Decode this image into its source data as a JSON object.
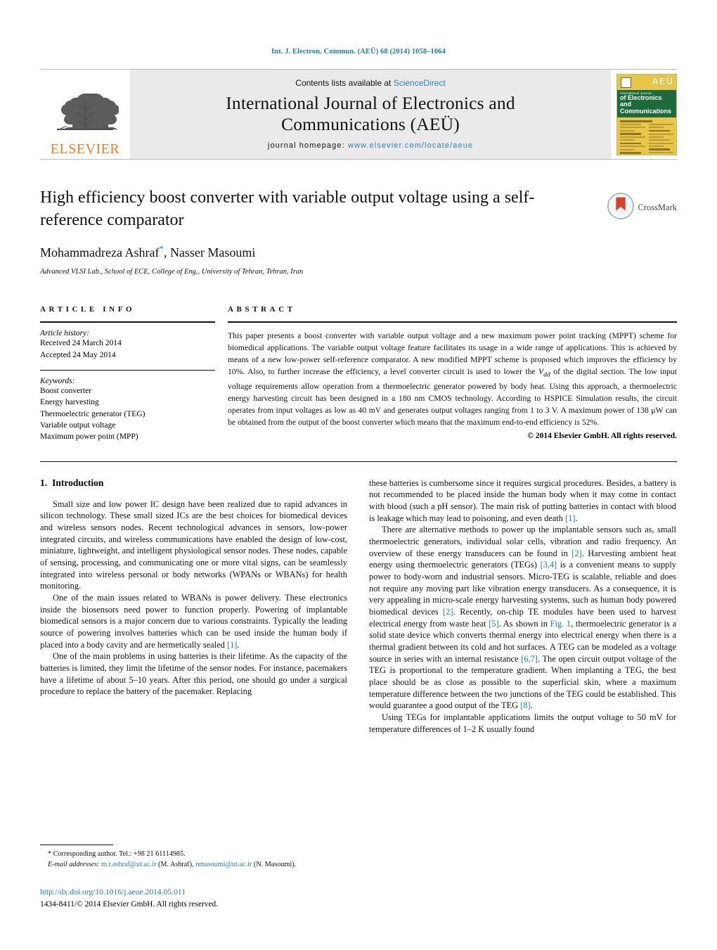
{
  "running_head": "Int. J. Electron. Commun. (AEÜ) 68 (2014) 1058–1064",
  "masthead": {
    "publisher": "ELSEVIER",
    "contents_prefix": "Contents lists available at ",
    "contents_link": "ScienceDirect",
    "journal_title_line1": "International Journal of Electronics and",
    "journal_title_line2": "Communications (AEÜ)",
    "homepage_label": "journal homepage:",
    "homepage_url": "www.elsevier.com/locate/aeue",
    "cover": {
      "aeu": "AEÜ",
      "sub": "International Journal",
      "line1": "of Electronics and",
      "line2": "Communications"
    }
  },
  "article": {
    "title": "High efficiency boost converter with variable output voltage using a self-reference comparator",
    "authors": "Mohammadreza Ashraf",
    "authors_rest": ", Nasser Masoumi",
    "corresponding_marker": "*",
    "affiliation": "Advanced VLSI Lab., School of ECE, College of Eng., University of Tehran, Tehran, Iran",
    "crossmark_label": "CrossMark"
  },
  "info": {
    "heading": "ARTICLE INFO",
    "history_label": "Article history:",
    "received": "Received 24 March 2014",
    "accepted": "Accepted 24 May 2014",
    "keywords_label": "Keywords:",
    "keywords": [
      "Boost converter",
      "Energy harvesting",
      "Thermoelectric generator (TEG)",
      "Variable output voltage",
      "Maximum power point (MPP)"
    ]
  },
  "abstract": {
    "heading": "ABSTRACT",
    "text": "This paper presents a boost converter with variable output voltage and a new maximum power point tracking (MPPT) scheme for biomedical applications. The variable output voltage feature facilitates its usage in a wide range of applications. This is achieved by means of a new low-power self-reference comparator. A new modified MPPT scheme is proposed which improves the efficiency by 10%. Also, to further increase the efficiency, a level converter circuit is used to lower the Vdd of the digital section. The low input voltage requirements allow operation from a thermoelectric generator powered by body heat. Using this approach, a thermoelectric energy harvesting circuit has been designed in a 180 nm CMOS technology. According to HSPICE Simulation results, the circuit operates from input voltages as low as 40 mV and generates output voltages ranging from 1 to 3 V. A maximum power of 138 μW can be obtained from the output of the boost converter which means that the maximum end-to-end efficiency is 52%.",
    "copyright": "© 2014 Elsevier GmbH. All rights reserved."
  },
  "body": {
    "section_number": "1.",
    "section_title": "Introduction",
    "left_paragraphs": [
      "Small size and low power IC design have been realized due to rapid advances in silicon technology. These small sized ICs are the best choices for biomedical devices and wireless sensors nodes. Recent technological advances in sensors, low-power integrated circuits, and wireless communications have enabled the design of low-cost, miniature, lightweight, and intelligent physiological sensor nodes. These nodes, capable of sensing, processing, and communicating one or more vital signs, can be seamlessly integrated into wireless personal or body networks (WPANs or WBANs) for health monitoring.",
      "One of the main issues related to WBANs is power delivery. These electronics inside the biosensors need power to function properly. Powering of implantable biomedical sensors is a major concern due to various constraints. Typically the leading source of powering involves batteries which can be used inside the human body if placed into a body cavity and are hermetically sealed [1].",
      "One of the main problems in using batteries is their lifetime. As the capacity of the batteries is limited, they limit the lifetime of the sensor nodes. For instance, pacemakers have a lifetime of about 5–10 years. After this period, one should go under a surgical procedure to replace the battery of the pacemaker. Replacing"
    ],
    "right_paragraphs": [
      "these batteries is cumbersome since it requires surgical procedures. Besides, a battery is not recommended to be placed inside the human body when it may come in contact with blood (such a pH sensor). The main risk of putting batteries in contact with blood is leakage which may lead to poisoning, and even death [1].",
      "There are alternative methods to power up the implantable sensors such as, small thermoelectric generators, individual solar cells, vibration and radio frequency. An overview of these energy transducers can be found in [2]. Harvesting ambient heat energy using thermoelectric generators (TEGs) [3,4] is a convenient means to supply power to body-worn and industrial sensors. Micro-TEG is scalable, reliable and does not require any moving part like vibration energy transducers. As a consequence, it is very appealing in micro-scale energy harvesting systems, such as human body powered biomedical devices [2]. Recently, on-chip TE modules have been used to harvest electrical energy from waste heat [5]. As shown in Fig. 1, thermoelectric generator is a solid state device which converts thermal energy into electrical energy when there is a thermal gradient between its cold and hot surfaces. A TEG can be modeled as a voltage source in series with an internal resistance [6,7]. The open circuit output voltage of the TEG is proportional to the temperature gradient. When implanting a TEG, the best place should be as close as possible to the superficial skin, where a maximum temperature difference between the two junctions of the TEG could be established. This would guarantee a good output of the TEG [8].",
      "Using TEGs for implantable applications limits the output voltage to 50 mV for temperature differences of 1–2 K usually found"
    ]
  },
  "footnote": {
    "corresponding": "* Corresponding author. Tel.: +98 21 61114985.",
    "email_label": "E-mail addresses:",
    "email1": "m.r.ashraf@ut.ac.ir",
    "email1_owner": "(M. Ashraf),",
    "email2": "nmasoumi@ut.ac.ir",
    "email2_owner": "(N. Masoumi).",
    "doi": "http://dx.doi.org/10.1016/j.aeue.2014.05.011",
    "issn": "1434-8411/© 2014 Elsevier GmbH. All rights reserved."
  },
  "colors": {
    "link": "#1a7fa8",
    "elsevier_orange": "#f08020",
    "masthead_bg": "#eaeaea",
    "cover_gold": "#e8c64a",
    "cover_green": "#1d6b3c"
  }
}
